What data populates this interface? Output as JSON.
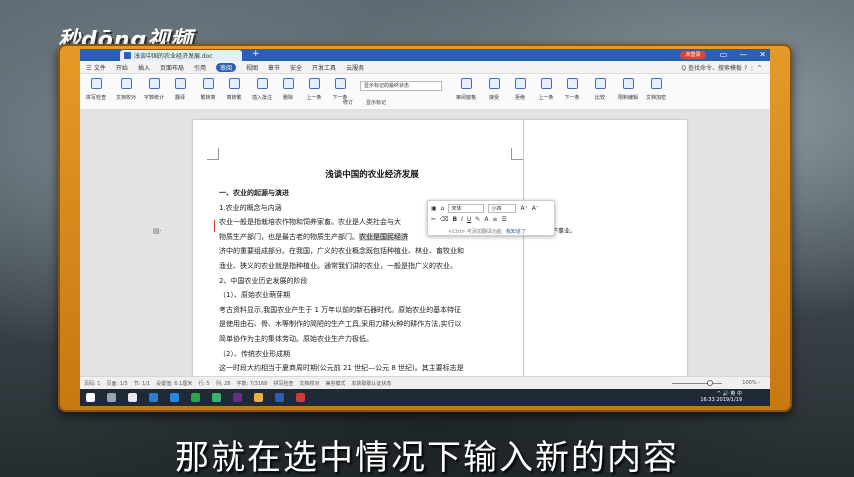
{
  "watermark": {
    "logo": "秒dōng视频"
  },
  "window": {
    "tab_title": "浅谈中国的农业经济发展.doc",
    "login": "未登录",
    "controls": [
      "▭",
      "—",
      "✕"
    ]
  },
  "menu": {
    "file": "三 文件",
    "items": [
      "开始",
      "插入",
      "页面布局",
      "引用",
      "审阅",
      "视图",
      "章节",
      "安全",
      "开发工具",
      "云服务"
    ],
    "active_index": 4,
    "right": "Q 查找命令、搜索模板 ? ⋮ ^"
  },
  "ribbon": {
    "buttons": [
      "拼写检查",
      "文档校对",
      "字数统计",
      "翻译",
      "繁转简",
      "简转繁",
      "插入批注",
      "删除",
      "上一条",
      "下一条",
      "修订",
      "显示标记",
      "审阅窗格",
      "接受",
      "拒绝",
      "上一条",
      "下一条",
      "比较",
      "限制编辑",
      "文档加密"
    ],
    "markup_select": "显示标记的最终状态"
  },
  "document": {
    "title": "浅谈中国的农业经济发展",
    "lines": [
      "一、农业的起源与演进",
      "1.农业的概念与内涵",
      "农业一般是指栽培农作物和饲养家畜。农业是人类社会与大",
      "物质生产部门，也是最古老的物质生产部门。农业是国民经济",
      "济中的重要组成部分。在我国，广义的农业概念既包括种植业、林业、畜牧业和",
      "渔业、狭义的农业就是指种植业。通常我们讲的农业，一般是指广义的农业。",
      "2、中国农业历史发展的阶段",
      "（1）、原始农业萌芽期",
      "考古资料显示,我国农业产生于 1 万年以前的新石器时代。原始农业的基本特征",
      "是使用由石、骨、木等制作的简陋的生产工具,采用刀耕火种的耕作方法,实行以",
      "简单协作为主的集体劳动。原始农业生产力极低。",
      "（2）、传统农业形成期",
      "这一时段大约相当于夏商周时期(公元前 21 世纪—公元 8 世纪)。其主要标志是"
    ],
    "highlight": "农业是国民经济",
    "comment": "家庭的生产事业。"
  },
  "mini_toolbar": {
    "font": "宋体",
    "size": "小四",
    "grow": "A⁺",
    "shrink": "A⁻",
    "bold": "B",
    "italic": "I",
    "underline": "U",
    "tip": "<Ctrl> 可添加翻译功能",
    "tip_link": "我知道了"
  },
  "status": {
    "items": [
      "页码: 1",
      "页面: 1/5",
      "节: 1/1",
      "设置值: 6.1厘米",
      "行: 5",
      "列: 28",
      "字数: 7/3168",
      "拼写检查",
      "文档校对",
      "兼容模式",
      "本获取取认证状态"
    ],
    "zoom": "100% -",
    "zoom_level": 0.76
  },
  "taskbar": {
    "time": "16:33",
    "date": "2019/1/19",
    "tray": "^ 🔊 英 中"
  },
  "subtitle": "那就在选中情况下输入新的内容"
}
